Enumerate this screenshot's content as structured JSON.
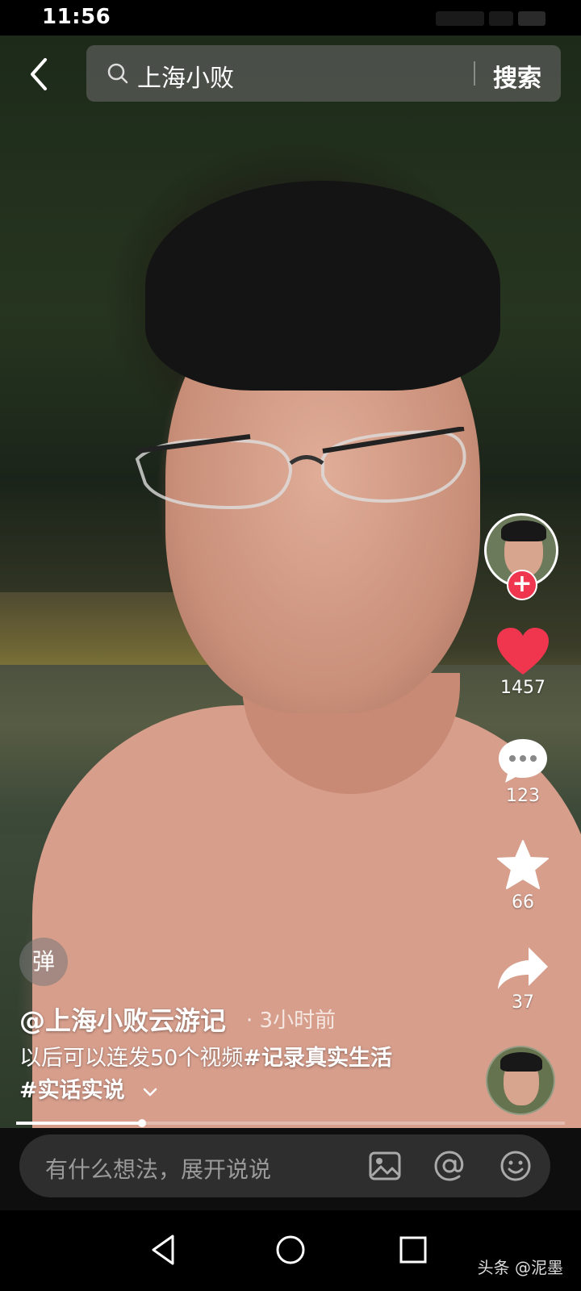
{
  "status_bar": {
    "time": "11:56"
  },
  "search": {
    "query": "上海小败",
    "button_label": "搜索"
  },
  "actions": {
    "likes": "1457",
    "comments": "123",
    "favorites": "66",
    "shares": "37",
    "follow_symbol": "+"
  },
  "danmu_label": "弹",
  "post": {
    "author": "@上海小败云游记",
    "time_ago": "· 3小时前",
    "caption_text": "以后可以连发50个视频",
    "hashtag_1": "#记录真实生活",
    "hashtag_2": "#实话实说"
  },
  "progress": {
    "fraction": 0.23
  },
  "comment_bar": {
    "placeholder": "有什么想法，展开说说"
  },
  "watermark": "头条 @泥墨",
  "colors": {
    "like_red": "#f0354f",
    "follow_red": "#f0354f"
  },
  "icons": [
    "back-icon",
    "search-icon",
    "heart-icon",
    "comment-icon",
    "star-icon",
    "share-icon",
    "chevron-down-icon",
    "image-icon",
    "at-icon",
    "emoji-icon",
    "nav-back-icon",
    "nav-home-icon",
    "nav-recents-icon"
  ]
}
